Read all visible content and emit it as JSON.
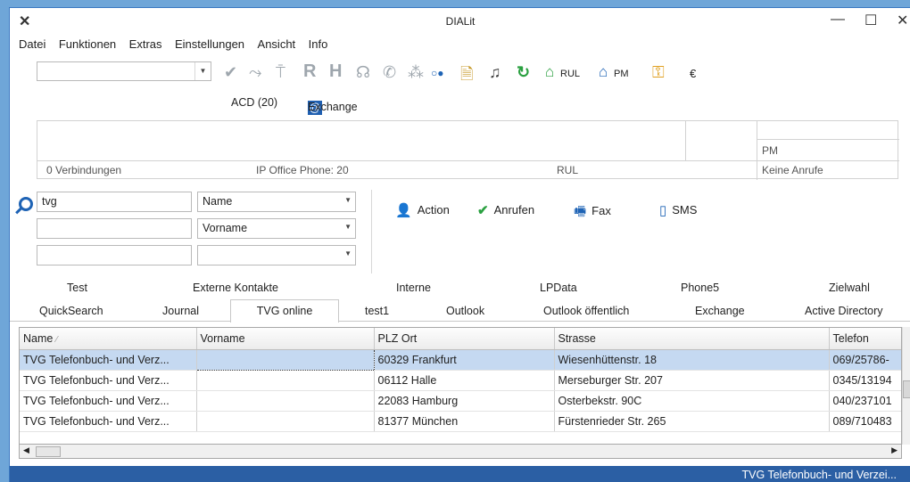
{
  "window": {
    "title": "DIALit",
    "close_glyph": "✕",
    "min_glyph": "—",
    "max_glyph": "☐",
    "xclose_glyph": "✕"
  },
  "menu": [
    "Datei",
    "Funktionen",
    "Extras",
    "Einstellungen",
    "Ansicht",
    "Info"
  ],
  "toolbar": {
    "combo_value": "",
    "icons": [
      "✔",
      "⤳",
      "⍑",
      "R",
      "H",
      "☊",
      "✆",
      "⁂",
      "○●",
      "🗎",
      "♫",
      "↻"
    ],
    "rul_label": "RUL",
    "pm_label": "PM",
    "euro_label": "€",
    "acd_label": "ACD (20)",
    "exchange_label": "Exchange"
  },
  "status": {
    "connections": "0 Verbindungen",
    "phone": "IP Office Phone: 20",
    "rul": "RUL",
    "pm": "PM",
    "calls": "Keine Anrufe"
  },
  "search": {
    "query": "tvg",
    "field1": "Name",
    "field2": "Vorname",
    "field3": "",
    "input2": "",
    "input3": ""
  },
  "actions": {
    "action": "Action",
    "call": "Anrufen",
    "fax": "Fax",
    "sms": "SMS"
  },
  "tabs_top": [
    "Test",
    "Externe Kontakte",
    "Interne",
    "LPData",
    "Phone5",
    "Zielwahl"
  ],
  "tabs_bottom": [
    "QuickSearch",
    "Journal",
    "TVG online",
    "test1",
    "Outlook",
    "Outlook öffentlich",
    "Exchange",
    "Active Directory"
  ],
  "grid": {
    "columns": [
      "Name",
      "Vorname",
      "PLZ Ort",
      "Strasse",
      "Telefon"
    ],
    "rows": [
      [
        "TVG Telefonbuch- und Verz...",
        "",
        "60329 Frankfurt",
        "Wiesenhüttenstr. 18",
        "069/25786-"
      ],
      [
        "TVG Telefonbuch- und Verz...",
        "",
        "06112 Halle",
        "Merseburger Str. 207",
        "0345/13194"
      ],
      [
        "TVG Telefonbuch- und Verz...",
        "",
        "22083 Hamburg",
        "Osterbekstr. 90C",
        "040/237101"
      ],
      [
        "TVG Telefonbuch- und Verz...",
        "",
        "81377 München",
        "Fürstenrieder Str. 265",
        "089/710483"
      ]
    ]
  },
  "statusbar": {
    "text": "TVG Telefonbuch- und Verzei..."
  },
  "colors": {
    "accent": "#2b5fa4",
    "selection": "#c5d9f1",
    "icon_green": "#2aa040",
    "icon_blue": "#1e63b5"
  }
}
